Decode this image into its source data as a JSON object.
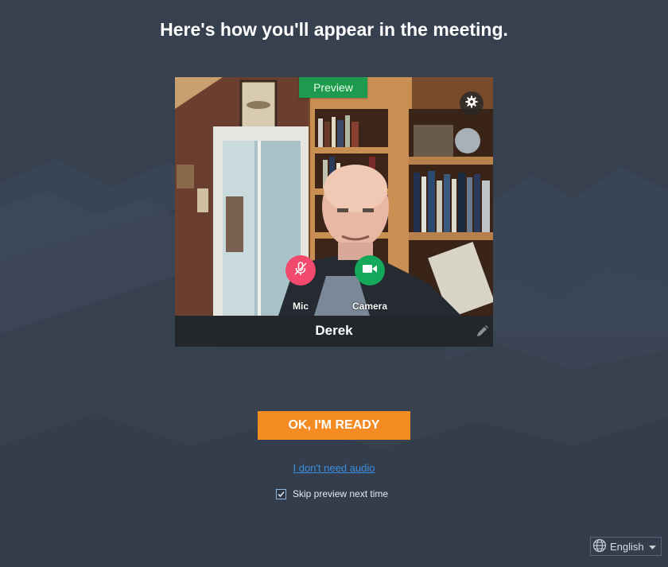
{
  "title": "Here's how you'll appear in the meeting.",
  "preview": {
    "tag": "Preview",
    "user_name": "Derek",
    "controls": {
      "mic_label": "Mic",
      "mic_state": "muted",
      "camera_label": "Camera",
      "camera_state": "on"
    }
  },
  "actions": {
    "ready_label": "OK, I'M READY",
    "no_audio_link": "I don't need audio",
    "skip_preview_label": "Skip preview next time",
    "skip_preview_checked": true
  },
  "language": {
    "selected": "English"
  },
  "icons": {
    "settings": "gear-icon",
    "mic": "mic-off-icon",
    "camera": "video-camera-icon",
    "edit": "pencil-icon",
    "language": "globe-icon",
    "dropdown": "caret-down-icon"
  },
  "colors": {
    "background": "#36404f",
    "preview_tag": "#1e9a4f",
    "mic_button": "#f2496d",
    "camera_button": "#13a85a",
    "ready_button": "#f48b23",
    "link": "#3a8fe0",
    "name_bar": "#23272b"
  }
}
